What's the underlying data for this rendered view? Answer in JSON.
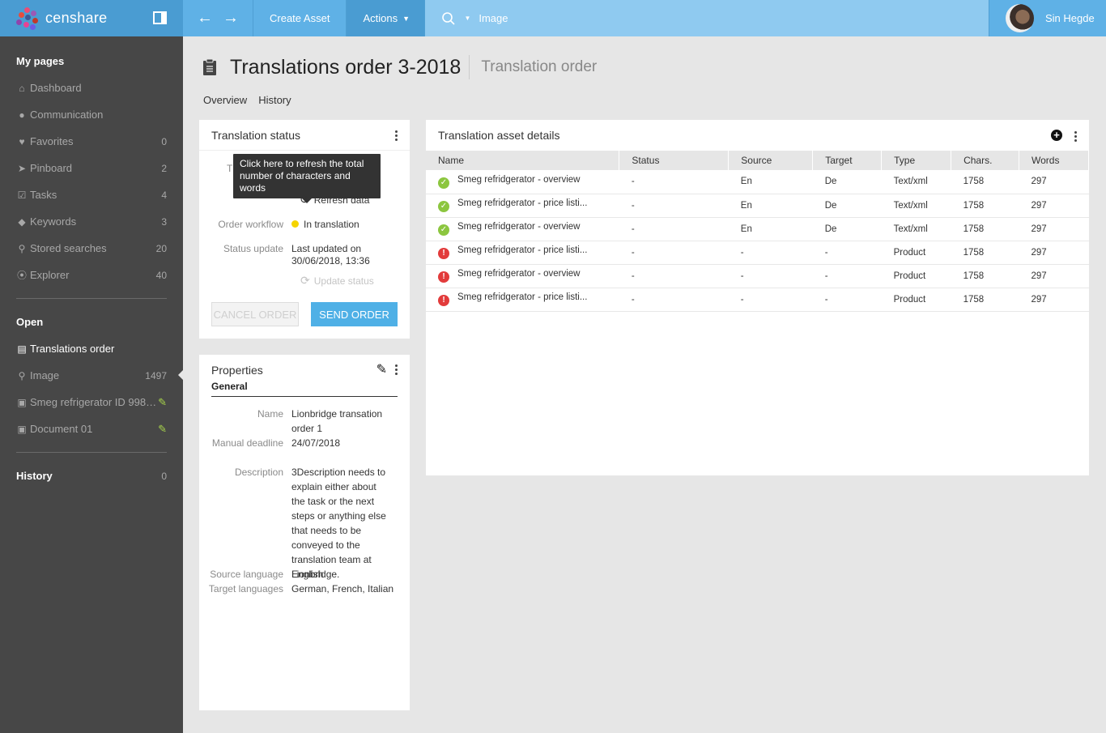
{
  "brand": {
    "name": "censhare"
  },
  "topbar": {
    "create_asset": "Create Asset",
    "actions": "Actions",
    "search_value": "Image",
    "user_name": "Sin Hegde"
  },
  "sidebar": {
    "my_pages": "My pages",
    "items": [
      {
        "label": "Dashboard",
        "icon": "home-icon",
        "count": ""
      },
      {
        "label": "Communication",
        "icon": "chat-icon",
        "count": ""
      },
      {
        "label": "Favorites",
        "icon": "heart-icon",
        "count": "0"
      },
      {
        "label": "Pinboard",
        "icon": "pin-icon",
        "count": "2"
      },
      {
        "label": "Tasks",
        "icon": "checkbox-icon",
        "count": "4"
      },
      {
        "label": "Keywords",
        "icon": "tag-icon",
        "count": "3"
      },
      {
        "label": "Stored searches",
        "icon": "search-icon",
        "count": "20"
      },
      {
        "label": "Explorer",
        "icon": "compass-icon",
        "count": "40"
      }
    ],
    "open": "Open",
    "open_items": [
      {
        "label": "Translations order",
        "icon": "clipboard-icon",
        "count": ""
      },
      {
        "label": "Image",
        "icon": "search-icon",
        "count": "1497"
      },
      {
        "label": "Smeg refrigerator ID 998…",
        "icon": "image-icon",
        "count": ""
      },
      {
        "label": "Document 01",
        "icon": "image-icon",
        "count": ""
      }
    ],
    "history": "History",
    "history_count": "0"
  },
  "page": {
    "title": "Translations order 3-2018",
    "subtitle": "Translation order",
    "tabs": [
      "Overview",
      "History"
    ]
  },
  "translation_status": {
    "title": "Translation status",
    "tooltip": "Click here to refresh the total number of characters and words",
    "hidden_label_fragment": "T",
    "refresh": "Refresh data",
    "order_workflow_label": "Order workflow",
    "order_workflow_value": "In translation",
    "status_update_label": "Status update",
    "status_update_value_1": "Last updated on",
    "status_update_value_2": "30/06/2018, 13:36",
    "update_status": "Update status",
    "cancel_order": "CANCEL ORDER",
    "send_order": "SEND ORDER",
    "status_color": "#f5d400"
  },
  "properties": {
    "title": "Properties",
    "tab": "General",
    "rows": [
      {
        "label": "Name",
        "value": "Lionbridge transation order 1"
      },
      {
        "label": "Manual deadline",
        "value": "24/07/2018"
      },
      {
        "label": "Description",
        "value": "3Description needs to explain either about the task or the next steps or anything else that needs to be conveyed to the translation team at Lionbridge."
      },
      {
        "label": "Source language",
        "value": "English"
      },
      {
        "label": "Target languages",
        "value": "German, French, Italian"
      }
    ]
  },
  "asset_details": {
    "title": "Translation asset details",
    "columns": [
      "Name",
      "Status",
      "Source",
      "Target",
      "Type",
      "Chars.",
      "Words"
    ],
    "rows": [
      {
        "state": "ok",
        "name": "Smeg refridgerator - overview",
        "status": "-",
        "source": "En",
        "target": "De",
        "type": "Text/xml",
        "chars": "1758",
        "words": "297"
      },
      {
        "state": "ok",
        "name": "Smeg refridgerator - price listi...",
        "status": "-",
        "source": "En",
        "target": "De",
        "type": "Text/xml",
        "chars": "1758",
        "words": "297"
      },
      {
        "state": "ok",
        "name": "Smeg refridgerator - overview",
        "status": "-",
        "source": "En",
        "target": "De",
        "type": "Text/xml",
        "chars": "1758",
        "words": "297"
      },
      {
        "state": "error",
        "name": "Smeg refridgerator - price listi...",
        "status": "-",
        "source": "-",
        "target": "-",
        "type": "Product",
        "chars": "1758",
        "words": "297"
      },
      {
        "state": "error",
        "name": "Smeg refridgerator - overview",
        "status": "-",
        "source": "-",
        "target": "-",
        "type": "Product",
        "chars": "1758",
        "words": "297"
      },
      {
        "state": "error",
        "name": "Smeg refridgerator - price listi...",
        "status": "-",
        "source": "-",
        "target": "-",
        "type": "Product",
        "chars": "1758",
        "words": "297"
      }
    ]
  }
}
